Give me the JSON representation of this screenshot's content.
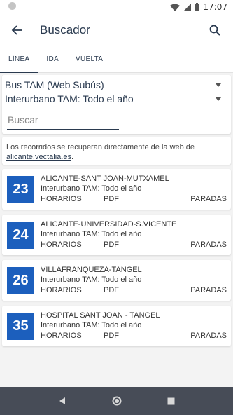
{
  "status_bar": {
    "time": "17:07"
  },
  "app_bar": {
    "title": "Buscador"
  },
  "tabs": [
    {
      "label": "LÍNEA"
    },
    {
      "label": "IDA"
    },
    {
      "label": "VUELTA"
    }
  ],
  "filters": {
    "company": "Bus TAM (Web Subús)",
    "schedule": "Interurbano TAM: Todo el año",
    "search_placeholder": "Buscar"
  },
  "info": {
    "text": "Los recorridos se recuperan directamente de la web de",
    "link": "alicante.vectalia.es",
    "suffix": "."
  },
  "routes": [
    {
      "number": "23",
      "name": "ALICANTE-SANT JOAN-MUTXAMEL",
      "subtitle": "Interurbano TAM: Todo el año",
      "horarios": "HORARIOS",
      "pdf": "PDF",
      "paradas": "PARADAS"
    },
    {
      "number": "24",
      "name": "ALICANTE-UNIVERSIDAD-S.VICENTE",
      "subtitle": "Interurbano TAM: Todo el año",
      "horarios": "HORARIOS",
      "pdf": "PDF",
      "paradas": "PARADAS"
    },
    {
      "number": "26",
      "name": "VILLAFRANQUEZA-TANGEL",
      "subtitle": "Interurbano TAM: Todo el año",
      "horarios": "HORARIOS",
      "pdf": "PDF",
      "paradas": "PARADAS"
    },
    {
      "number": "35",
      "name": "HOSPITAL SANT JOAN - TANGEL",
      "subtitle": "Interurbano TAM: Todo el año",
      "horarios": "HORARIOS",
      "pdf": "PDF",
      "paradas": "PARADAS"
    }
  ],
  "colors": {
    "primary": "#2a3a4f",
    "badge": "#1c5fbd",
    "nav_bar": "#474c57"
  },
  "icons": {
    "back": "arrow-left-icon",
    "search": "search-icon",
    "wifi": "wifi-icon",
    "signal": "signal-icon",
    "battery": "battery-icon",
    "nav_back": "triangle-back-icon",
    "nav_home": "circle-home-icon",
    "nav_recents": "square-recents-icon"
  }
}
